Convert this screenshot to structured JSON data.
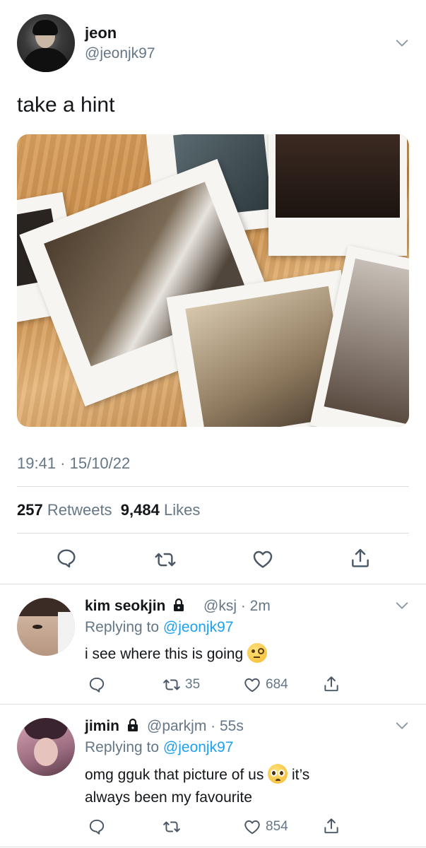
{
  "tweet": {
    "author_name": "jeon",
    "author_handle": "@jeonjk97",
    "text": "take a hint",
    "timestamp": "19:41 · 15/10/22",
    "retweets_count": "257",
    "retweets_label": "Retweets",
    "likes_count": "9,484",
    "likes_label": "Likes"
  },
  "replies": [
    {
      "name": "kim seokjin",
      "handle": "@ksj",
      "time": "· 2m",
      "replying_label": "Replying to",
      "replying_to": "@jeonjk97",
      "text": "i see where this is going",
      "emoji": "face-with-monocle",
      "retweets": "35",
      "likes": "684"
    },
    {
      "name": "jimin",
      "handle": "@parkjm",
      "time": "· 55s",
      "replying_label": "Replying to",
      "replying_to": "@jeonjk97",
      "text_before": "omg gguk that picture of us",
      "emoji": "pleading-face",
      "text_after": "it’s",
      "text_line2": "always been my favourite",
      "retweets": "",
      "likes": "854"
    }
  ],
  "colors": {
    "link": "#1da1f2",
    "muted": "#657786",
    "divider": "#d9dfe3"
  }
}
